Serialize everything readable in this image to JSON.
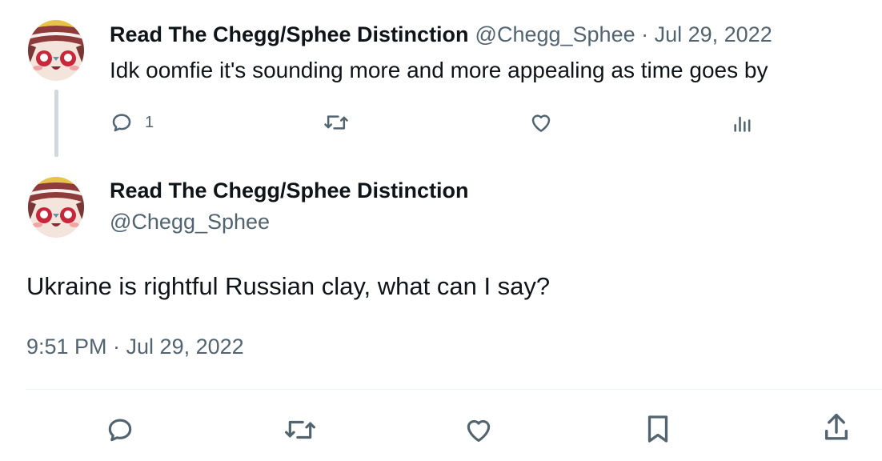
{
  "reply_tweet": {
    "author_name": "Read The Chegg/Sphee Distinction",
    "handle_date": "@Chegg_Sphee · Jul 29, 2022",
    "text": "Idk oomfie it's sounding more and more appealing as time goes by",
    "reply_count": "1"
  },
  "main_tweet": {
    "author_name": "Read The Chegg/Sphee Distinction",
    "handle": "@Chegg_Sphee",
    "text": "Ukraine is rightful Russian clay, what can I say?",
    "timestamp": "9:51 PM · Jul 29, 2022"
  },
  "colors": {
    "text": "#0f1419",
    "secondary": "#536471",
    "icon": "#536471",
    "divider": "#eff3f4"
  },
  "icons": {
    "reply": "speech-bubble-icon",
    "retweet": "retweet-arrows-icon",
    "like": "heart-icon",
    "views": "bar-chart-icon",
    "bookmark": "bookmark-icon",
    "share": "upload-share-icon"
  }
}
